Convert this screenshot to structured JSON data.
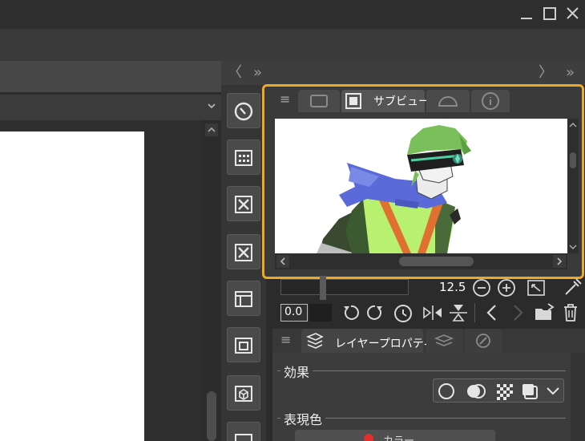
{
  "window": {
    "minimize_glyph": "—",
    "maximize_glyph": "□",
    "close_glyph": "✕"
  },
  "panels": {
    "collapse_left": "〈",
    "expand_double": "»",
    "collapse_right": "〉",
    "expand_double_right": "»"
  },
  "subview": {
    "tab_label": "サブビュー",
    "menu_glyph": "≡"
  },
  "navigator": {
    "zoom_value": "12.5",
    "rotation_value": "0.0"
  },
  "layer_property": {
    "tab_label": "レイヤープロパティ",
    "menu_glyph": "≡",
    "effect_label": "効果",
    "expression_color_label": "表現色",
    "color_button_label": "カラー"
  },
  "icons": {
    "tools": [
      "zoom-target-icon",
      "calendar-grid-icon",
      "x-frame-icon",
      "x-frame-icon",
      "layer-panel-icon",
      "layer-image-icon",
      "cube-box-icon",
      "folder-icon"
    ],
    "effect_options": [
      "circle-icon",
      "overlap-circle-icon",
      "checker-icon",
      "square-layer-icon",
      "chevron-down-icon"
    ]
  },
  "colors": {
    "highlight": "#f0a820",
    "scarf": "#5a6ad8",
    "hair": "#7ac05a",
    "jacket": "#b8f070",
    "strap": "#e07030"
  }
}
